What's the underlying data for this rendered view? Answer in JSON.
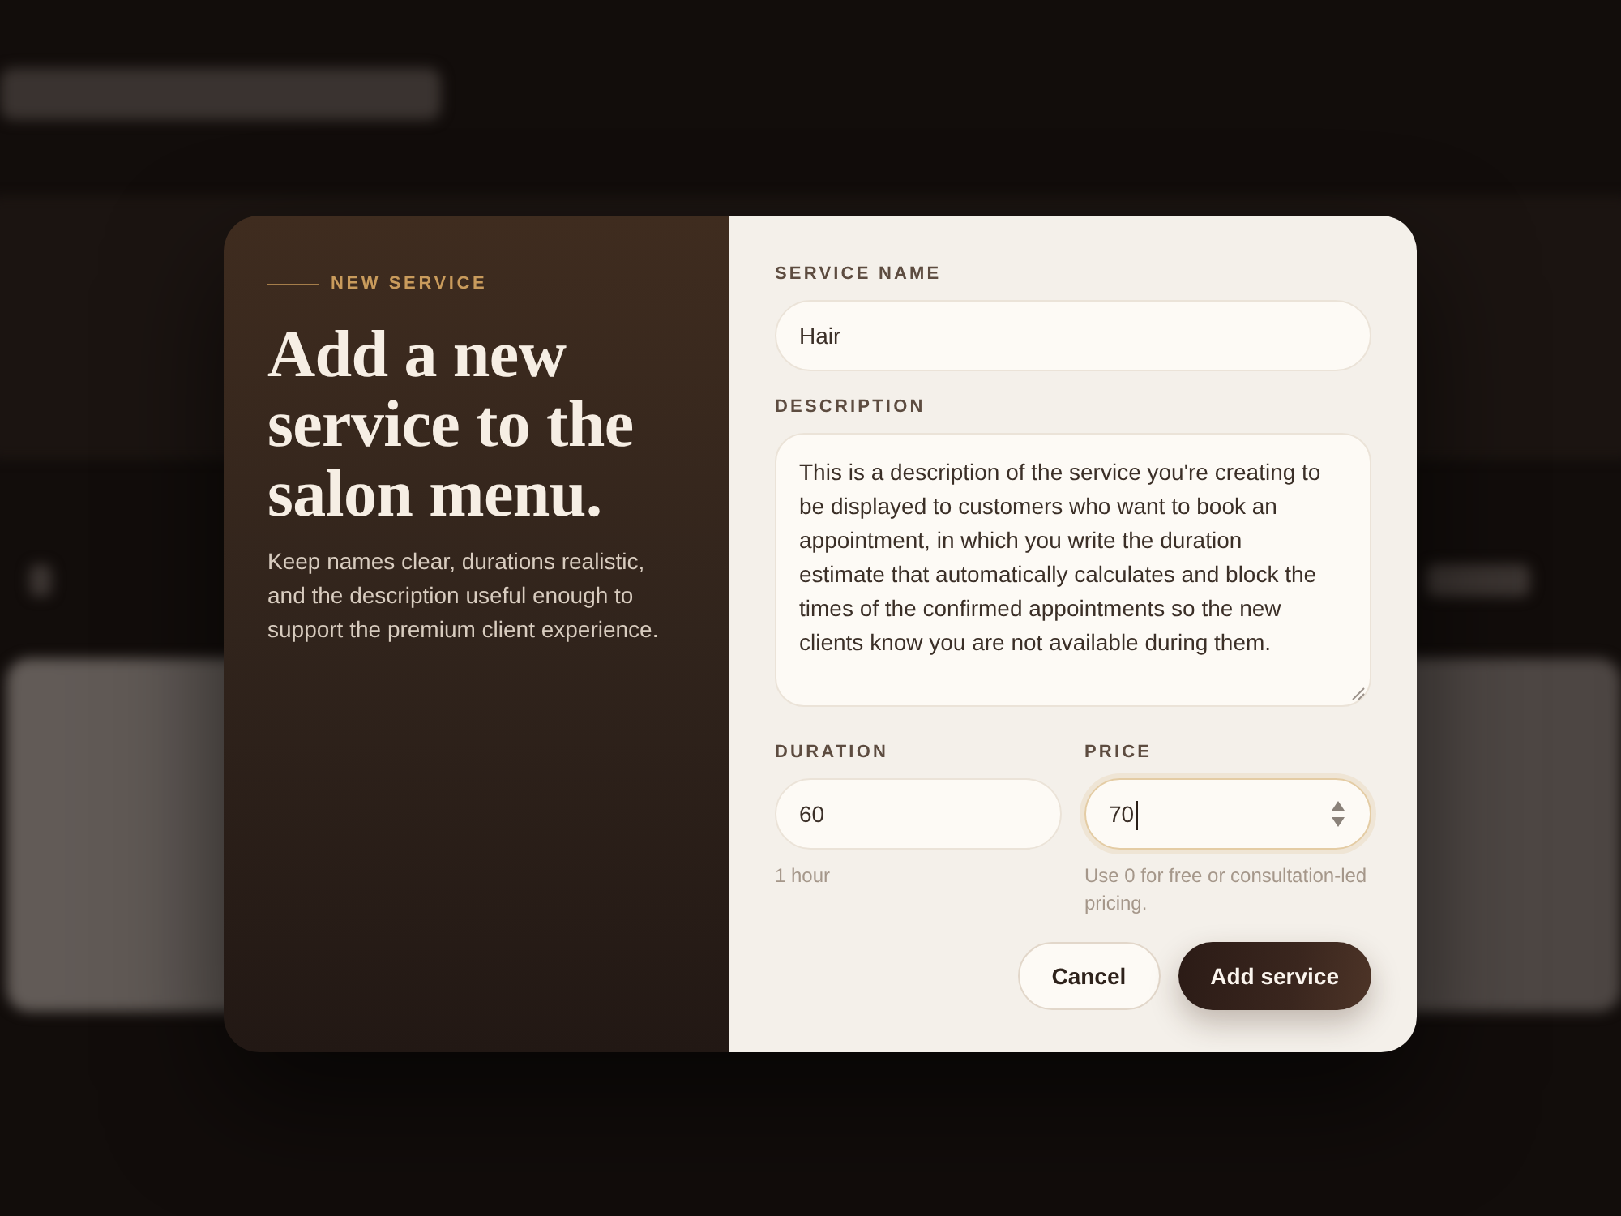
{
  "dialog": {
    "eyebrow": "NEW SERVICE",
    "heading": "Add a new service to the salon menu.",
    "intro": "Keep names clear, durations realistic, and the description useful enough to support the premium client experience.",
    "fields": [
      {
        "kind": "text",
        "label": "SERVICE NAME",
        "value": "Hair",
        "focused": false
      },
      {
        "kind": "textarea",
        "label": "DESCRIPTION",
        "value": "This is a description of the service you're creating to be displayed to customers who want to book an appointment, in which you write the duration estimate that automatically calculates and block the times of the confirmed appointments so the new clients know you are not available during them.",
        "focused": false
      },
      {
        "kind": "number",
        "label": "DURATION",
        "value": "60",
        "hint": "1 hour",
        "focused": false
      },
      {
        "kind": "number",
        "label": "PRICE",
        "value": "70",
        "hint": "Use 0 for free or consultation-led pricing.",
        "focused": true
      }
    ],
    "buttons": [
      {
        "label": "Cancel",
        "kind": "secondary"
      },
      {
        "label": "Add service",
        "kind": "primary"
      }
    ]
  }
}
